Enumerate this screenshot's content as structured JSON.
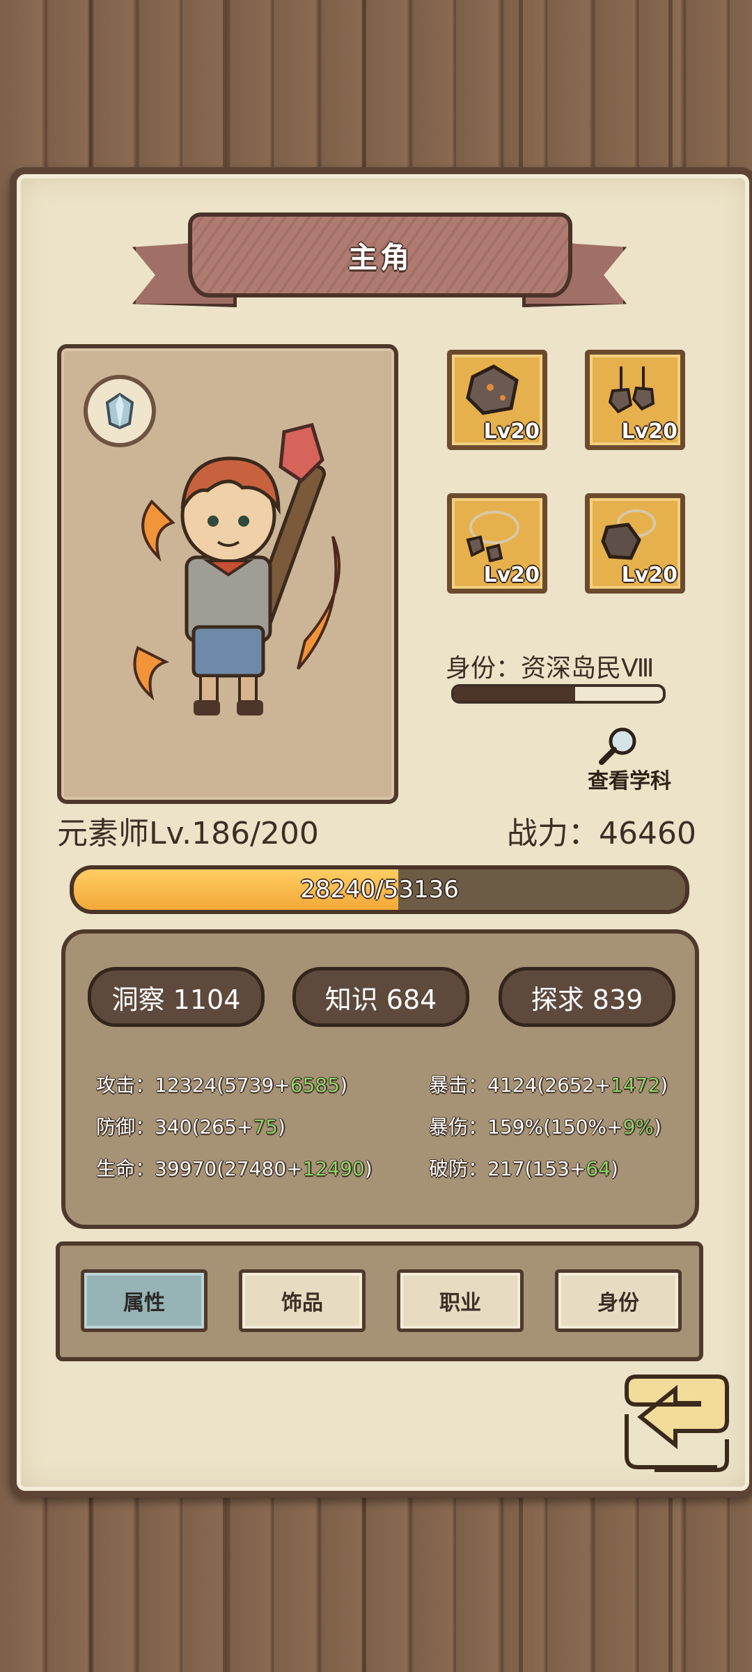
{
  "title": "主角",
  "equipment": [
    {
      "label": "Lv20",
      "icon": "rock-ore-icon"
    },
    {
      "label": "Lv20",
      "icon": "earring-icon"
    },
    {
      "label": "Lv20",
      "icon": "stone-bracelet-icon"
    },
    {
      "label": "Lv20",
      "icon": "rock-pendant-icon"
    }
  ],
  "identity": {
    "label": "身份：资深岛民Ⅷ",
    "progress": 0.58
  },
  "view_subject_label": "查看学科",
  "class_level": "元素师Lv.186/200",
  "power": "战力：46460",
  "xp": {
    "text": "28240/53136",
    "progress": 0.531
  },
  "attributes": [
    {
      "label": "洞察 1104"
    },
    {
      "label": "知识 684"
    },
    {
      "label": "探求 839"
    }
  ],
  "stats_left": [
    {
      "base": "攻击：12324(5739+",
      "bonus": "6585",
      "end": ")"
    },
    {
      "base": "防御：340(265+",
      "bonus": "75",
      "end": ")"
    },
    {
      "base": "生命：39970(27480+",
      "bonus": "12490",
      "end": ")"
    }
  ],
  "stats_right": [
    {
      "base": "暴击：4124(2652+",
      "bonus": "1472",
      "end": ")"
    },
    {
      "base": "暴伤：159%(150%+",
      "bonus": "9%",
      "end": ")"
    },
    {
      "base": "破防：217(153+",
      "bonus": "64",
      "end": ")"
    }
  ],
  "tabs": [
    {
      "label": "属性",
      "active": true
    },
    {
      "label": "饰品",
      "active": false
    },
    {
      "label": "职业",
      "active": false
    },
    {
      "label": "身份",
      "active": false
    }
  ],
  "colors": {
    "xp_fill": "#f5b23e",
    "bonus_text": "#8fd46c",
    "active_tab": "#96b3b6"
  }
}
